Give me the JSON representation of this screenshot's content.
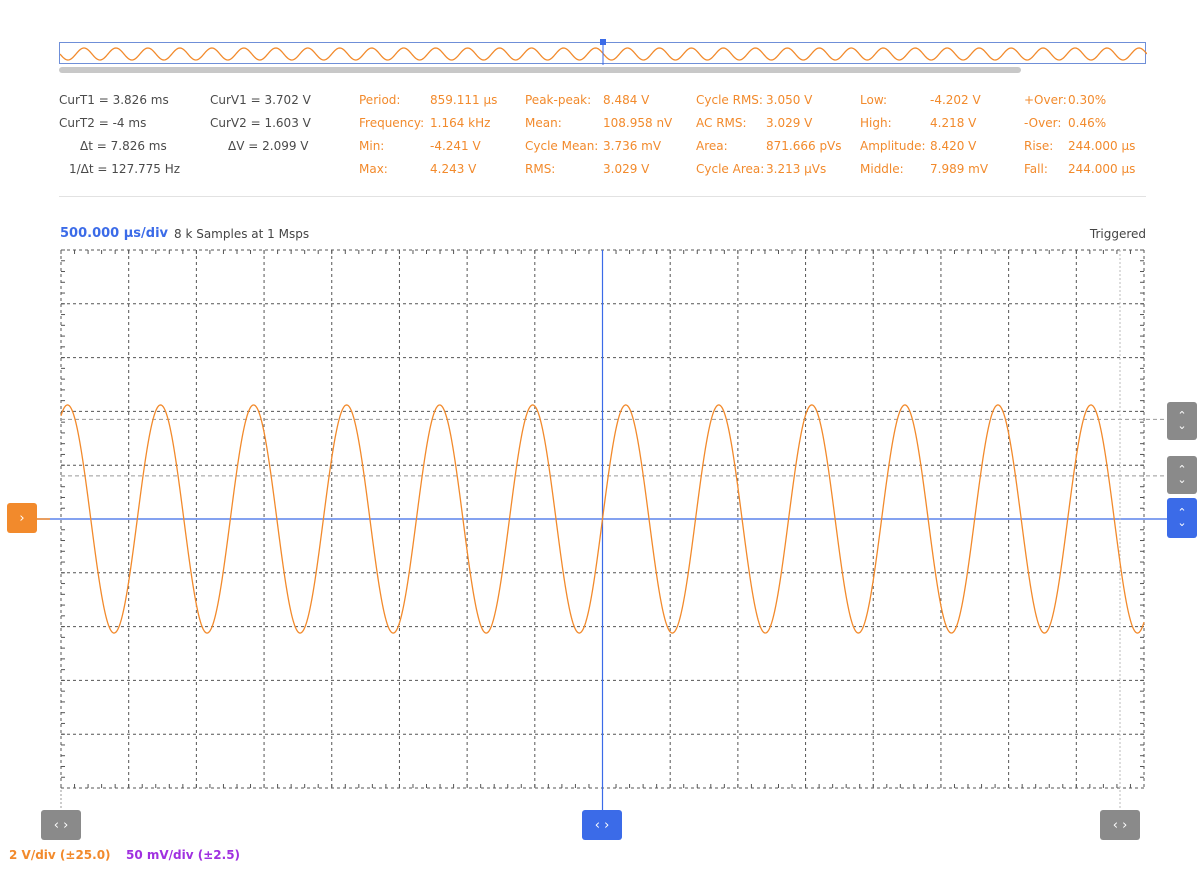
{
  "cursors": {
    "time": [
      {
        "label": "CurT1 =",
        "value": "3.826 ms"
      },
      {
        "label": "CurT2 =",
        "value": "-4 ms"
      },
      {
        "label": "Δt =",
        "value": "7.826 ms"
      },
      {
        "label": "1/Δt =",
        "value": "127.775 Hz"
      }
    ],
    "voltage": [
      {
        "label": "CurV1 =",
        "value": "3.702 V"
      },
      {
        "label": "CurV2 =",
        "value": "1.603 V"
      },
      {
        "label": "ΔV =",
        "value": "2.099 V"
      }
    ]
  },
  "measurements": {
    "col1": [
      {
        "label": "Period:",
        "value": "859.111 µs"
      },
      {
        "label": "Frequency:",
        "value": "1.164 kHz"
      },
      {
        "label": "Min:",
        "value": "-4.241 V"
      },
      {
        "label": "Max:",
        "value": "4.243 V"
      }
    ],
    "col2": [
      {
        "label": "Peak-peak:",
        "value": "8.484 V"
      },
      {
        "label": "Mean:",
        "value": "108.958 nV"
      },
      {
        "label": "Cycle Mean:",
        "value": "3.736 mV"
      },
      {
        "label": "RMS:",
        "value": "3.029 V"
      }
    ],
    "col3": [
      {
        "label": "Cycle RMS:",
        "value": "3.050 V"
      },
      {
        "label": "AC RMS:",
        "value": "3.029 V"
      },
      {
        "label": "Area:",
        "value": "871.666 pVs"
      },
      {
        "label": "Cycle Area:",
        "value": "3.213 µVs"
      }
    ],
    "col4": [
      {
        "label": "Low:",
        "value": "-4.202 V"
      },
      {
        "label": "High:",
        "value": "4.218 V"
      },
      {
        "label": "Amplitude:",
        "value": "8.420 V"
      },
      {
        "label": "Middle:",
        "value": "7.989 mV"
      }
    ],
    "col5": [
      {
        "label": "+Over:",
        "value": "0.30%"
      },
      {
        "label": "-Over:",
        "value": "0.46%"
      },
      {
        "label": "Rise:",
        "value": "244.000 µs"
      },
      {
        "label": "Fall:",
        "value": "244.000 µs"
      }
    ]
  },
  "scope": {
    "timebase": "500.000 µs/div",
    "samples": "8 k Samples at 1 Msps",
    "status": "Triggered",
    "ch1_scale": "2 V/div (±25.0)",
    "ch2_scale": "50 mV/div (±2.5)"
  },
  "waveform": {
    "amplitude_v": 4.24,
    "frequency_hz": 1164,
    "trigger_time_ms": 0,
    "time_range_ms": [
      -5,
      5
    ],
    "volts_per_div": 2
  },
  "colors": {
    "channel1": "#f28a2c",
    "channel2": "#a030e0",
    "accent": "#3b6be8",
    "grid": "#555555"
  },
  "icons": {
    "left_right": "‹ ›",
    "up_down": [
      "⌃",
      "⌄"
    ],
    "channel_marker": "›"
  }
}
